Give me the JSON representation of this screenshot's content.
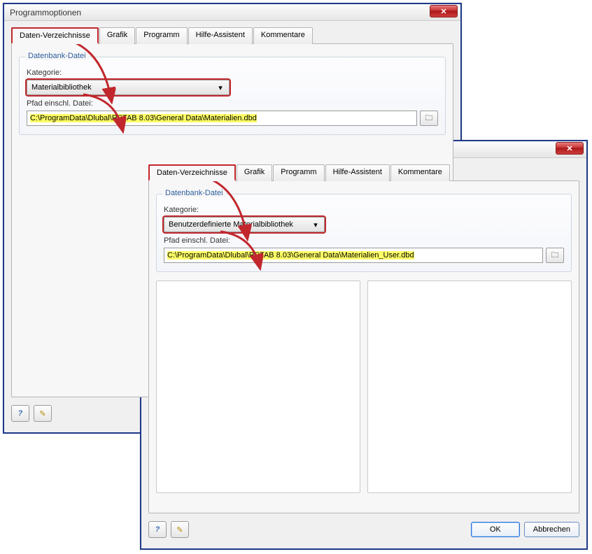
{
  "window_title": "Programmoptionen",
  "close_glyph": "✕",
  "tabs": {
    "t0": "Daten-Verzeichnisse",
    "t1": "Grafik",
    "t2": "Programm",
    "t3": "Hilfe-Assistent",
    "t4": "Kommentare"
  },
  "group_legend": "Datenbank-Datei",
  "kategorie_label": "Kategorie:",
  "pfad_label": "Pfad einschl. Datei:",
  "back": {
    "combo_value": "Materialbibliothek",
    "path_value": "C:\\ProgramData\\Dlubal\\RSTAB 8.03\\General Data\\Materialien.dbd"
  },
  "front": {
    "combo_value": "Benutzerdefinierte Materialbibliothek",
    "path_value": "C:\\ProgramData\\Dlubal\\RSTAB 8.03\\General Data\\Materialien_User.dbd"
  },
  "buttons": {
    "ok": "OK",
    "cancel": "Abbrechen"
  },
  "glyphs": {
    "dropdown": "▾",
    "help": "?",
    "edit": "✎",
    "folder": "🗀"
  }
}
